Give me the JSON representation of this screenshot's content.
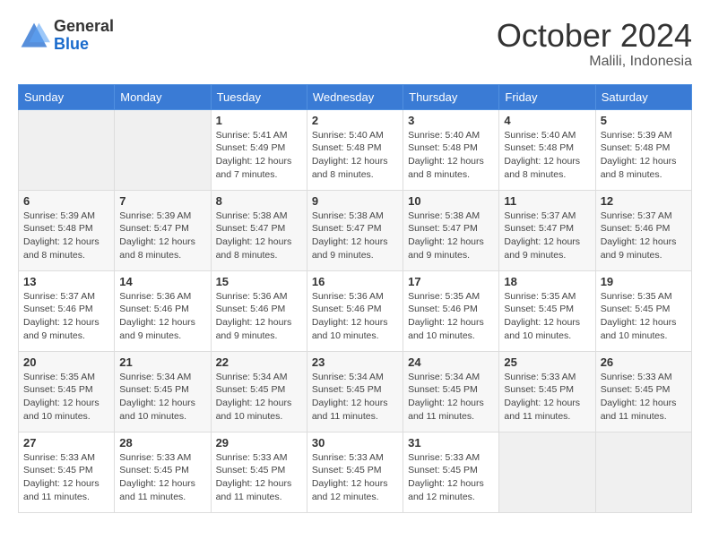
{
  "header": {
    "logo_general": "General",
    "logo_blue": "Blue",
    "month_title": "October 2024",
    "location": "Malili, Indonesia"
  },
  "days_of_week": [
    "Sunday",
    "Monday",
    "Tuesday",
    "Wednesday",
    "Thursday",
    "Friday",
    "Saturday"
  ],
  "weeks": [
    [
      {
        "day": "",
        "sunrise": "",
        "sunset": "",
        "daylight": ""
      },
      {
        "day": "",
        "sunrise": "",
        "sunset": "",
        "daylight": ""
      },
      {
        "day": "1",
        "sunrise": "Sunrise: 5:41 AM",
        "sunset": "Sunset: 5:49 PM",
        "daylight": "Daylight: 12 hours and 7 minutes."
      },
      {
        "day": "2",
        "sunrise": "Sunrise: 5:40 AM",
        "sunset": "Sunset: 5:48 PM",
        "daylight": "Daylight: 12 hours and 8 minutes."
      },
      {
        "day": "3",
        "sunrise": "Sunrise: 5:40 AM",
        "sunset": "Sunset: 5:48 PM",
        "daylight": "Daylight: 12 hours and 8 minutes."
      },
      {
        "day": "4",
        "sunrise": "Sunrise: 5:40 AM",
        "sunset": "Sunset: 5:48 PM",
        "daylight": "Daylight: 12 hours and 8 minutes."
      },
      {
        "day": "5",
        "sunrise": "Sunrise: 5:39 AM",
        "sunset": "Sunset: 5:48 PM",
        "daylight": "Daylight: 12 hours and 8 minutes."
      }
    ],
    [
      {
        "day": "6",
        "sunrise": "Sunrise: 5:39 AM",
        "sunset": "Sunset: 5:48 PM",
        "daylight": "Daylight: 12 hours and 8 minutes."
      },
      {
        "day": "7",
        "sunrise": "Sunrise: 5:39 AM",
        "sunset": "Sunset: 5:47 PM",
        "daylight": "Daylight: 12 hours and 8 minutes."
      },
      {
        "day": "8",
        "sunrise": "Sunrise: 5:38 AM",
        "sunset": "Sunset: 5:47 PM",
        "daylight": "Daylight: 12 hours and 8 minutes."
      },
      {
        "day": "9",
        "sunrise": "Sunrise: 5:38 AM",
        "sunset": "Sunset: 5:47 PM",
        "daylight": "Daylight: 12 hours and 9 minutes."
      },
      {
        "day": "10",
        "sunrise": "Sunrise: 5:38 AM",
        "sunset": "Sunset: 5:47 PM",
        "daylight": "Daylight: 12 hours and 9 minutes."
      },
      {
        "day": "11",
        "sunrise": "Sunrise: 5:37 AM",
        "sunset": "Sunset: 5:47 PM",
        "daylight": "Daylight: 12 hours and 9 minutes."
      },
      {
        "day": "12",
        "sunrise": "Sunrise: 5:37 AM",
        "sunset": "Sunset: 5:46 PM",
        "daylight": "Daylight: 12 hours and 9 minutes."
      }
    ],
    [
      {
        "day": "13",
        "sunrise": "Sunrise: 5:37 AM",
        "sunset": "Sunset: 5:46 PM",
        "daylight": "Daylight: 12 hours and 9 minutes."
      },
      {
        "day": "14",
        "sunrise": "Sunrise: 5:36 AM",
        "sunset": "Sunset: 5:46 PM",
        "daylight": "Daylight: 12 hours and 9 minutes."
      },
      {
        "day": "15",
        "sunrise": "Sunrise: 5:36 AM",
        "sunset": "Sunset: 5:46 PM",
        "daylight": "Daylight: 12 hours and 9 minutes."
      },
      {
        "day": "16",
        "sunrise": "Sunrise: 5:36 AM",
        "sunset": "Sunset: 5:46 PM",
        "daylight": "Daylight: 12 hours and 10 minutes."
      },
      {
        "day": "17",
        "sunrise": "Sunrise: 5:35 AM",
        "sunset": "Sunset: 5:46 PM",
        "daylight": "Daylight: 12 hours and 10 minutes."
      },
      {
        "day": "18",
        "sunrise": "Sunrise: 5:35 AM",
        "sunset": "Sunset: 5:45 PM",
        "daylight": "Daylight: 12 hours and 10 minutes."
      },
      {
        "day": "19",
        "sunrise": "Sunrise: 5:35 AM",
        "sunset": "Sunset: 5:45 PM",
        "daylight": "Daylight: 12 hours and 10 minutes."
      }
    ],
    [
      {
        "day": "20",
        "sunrise": "Sunrise: 5:35 AM",
        "sunset": "Sunset: 5:45 PM",
        "daylight": "Daylight: 12 hours and 10 minutes."
      },
      {
        "day": "21",
        "sunrise": "Sunrise: 5:34 AM",
        "sunset": "Sunset: 5:45 PM",
        "daylight": "Daylight: 12 hours and 10 minutes."
      },
      {
        "day": "22",
        "sunrise": "Sunrise: 5:34 AM",
        "sunset": "Sunset: 5:45 PM",
        "daylight": "Daylight: 12 hours and 10 minutes."
      },
      {
        "day": "23",
        "sunrise": "Sunrise: 5:34 AM",
        "sunset": "Sunset: 5:45 PM",
        "daylight": "Daylight: 12 hours and 11 minutes."
      },
      {
        "day": "24",
        "sunrise": "Sunrise: 5:34 AM",
        "sunset": "Sunset: 5:45 PM",
        "daylight": "Daylight: 12 hours and 11 minutes."
      },
      {
        "day": "25",
        "sunrise": "Sunrise: 5:33 AM",
        "sunset": "Sunset: 5:45 PM",
        "daylight": "Daylight: 12 hours and 11 minutes."
      },
      {
        "day": "26",
        "sunrise": "Sunrise: 5:33 AM",
        "sunset": "Sunset: 5:45 PM",
        "daylight": "Daylight: 12 hours and 11 minutes."
      }
    ],
    [
      {
        "day": "27",
        "sunrise": "Sunrise: 5:33 AM",
        "sunset": "Sunset: 5:45 PM",
        "daylight": "Daylight: 12 hours and 11 minutes."
      },
      {
        "day": "28",
        "sunrise": "Sunrise: 5:33 AM",
        "sunset": "Sunset: 5:45 PM",
        "daylight": "Daylight: 12 hours and 11 minutes."
      },
      {
        "day": "29",
        "sunrise": "Sunrise: 5:33 AM",
        "sunset": "Sunset: 5:45 PM",
        "daylight": "Daylight: 12 hours and 11 minutes."
      },
      {
        "day": "30",
        "sunrise": "Sunrise: 5:33 AM",
        "sunset": "Sunset: 5:45 PM",
        "daylight": "Daylight: 12 hours and 12 minutes."
      },
      {
        "day": "31",
        "sunrise": "Sunrise: 5:33 AM",
        "sunset": "Sunset: 5:45 PM",
        "daylight": "Daylight: 12 hours and 12 minutes."
      },
      {
        "day": "",
        "sunrise": "",
        "sunset": "",
        "daylight": ""
      },
      {
        "day": "",
        "sunrise": "",
        "sunset": "",
        "daylight": ""
      }
    ]
  ]
}
